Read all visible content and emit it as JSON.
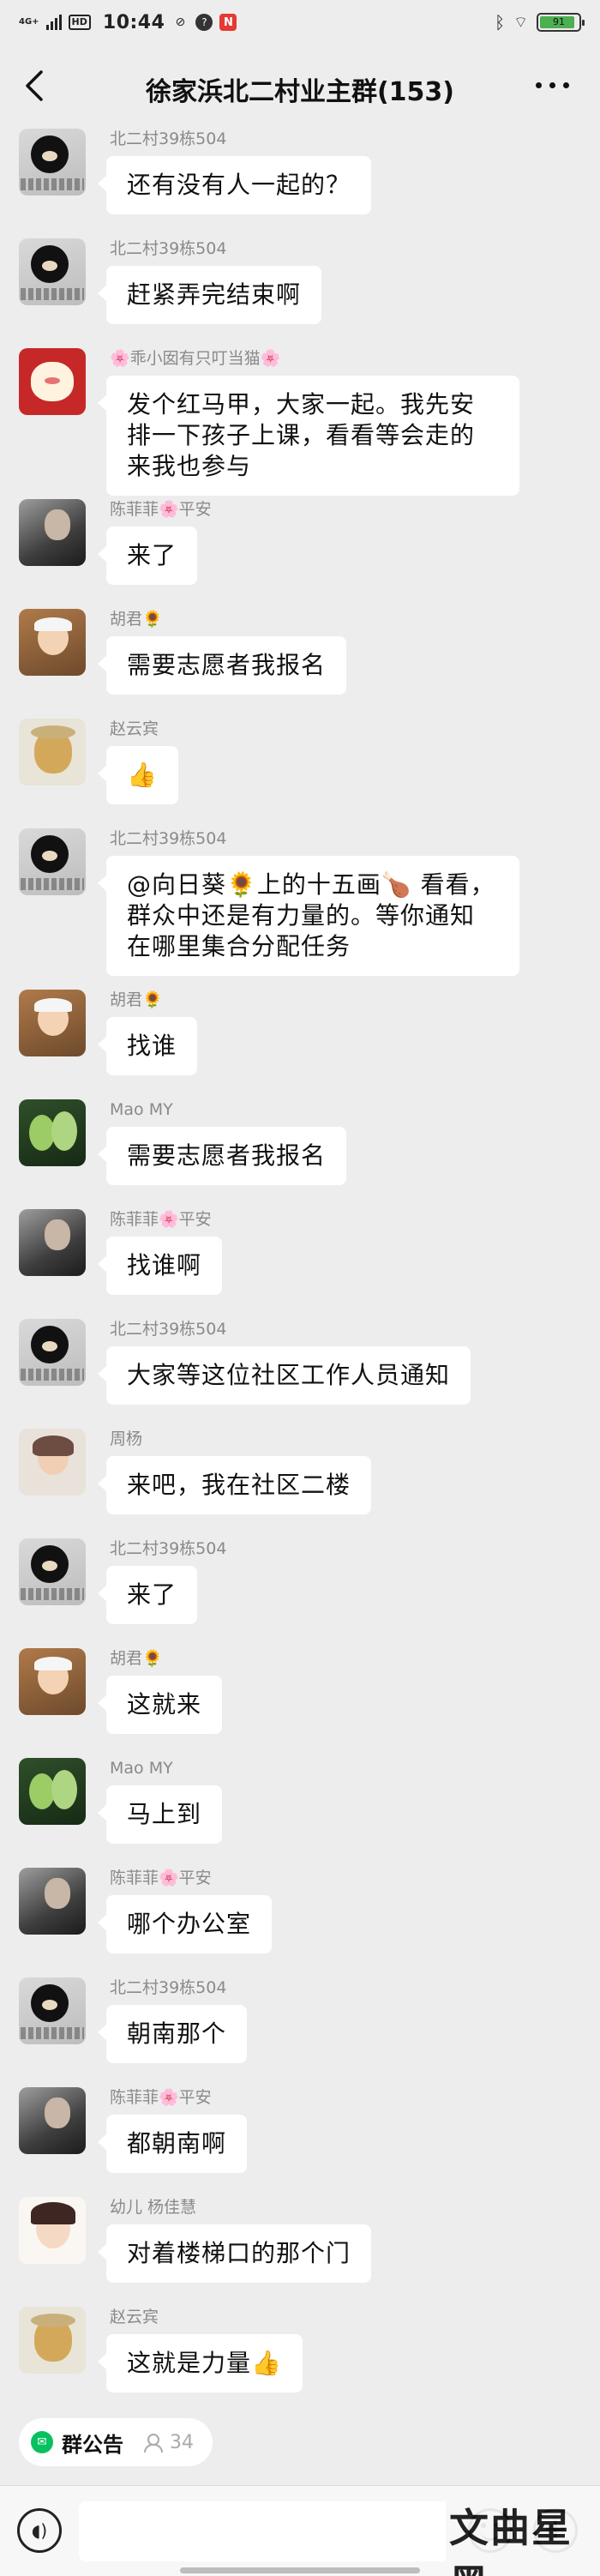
{
  "status_bar": {
    "network": "4G+",
    "hd": "HD",
    "time": "10:44",
    "battery_level": 0.91,
    "battery_text": "91",
    "bluetooth_icon": "bluetooth-icon",
    "wifi_icon": "wifi-icon"
  },
  "nav": {
    "title": "徐家浜北二村业主群(153)",
    "back_icon": "chevron-left-icon",
    "more_icon": "more-dots-icon"
  },
  "messages": [
    {
      "sender": "北二村39栋504",
      "text": "还有没有人一起的？",
      "avatar": "kuma"
    },
    {
      "sender": "北二村39栋504",
      "text": "赶紧弄完结束啊",
      "avatar": "kuma"
    },
    {
      "sender": "🌸乖小囡有只叮当猫🌸",
      "text": "发个红马甲，大家一起。我先安排一下孩子上课，看看等会走的来我也参与",
      "avatar": "cat"
    },
    {
      "sender": "陈菲菲🌸平安",
      "text": "来了",
      "avatar": "chen"
    },
    {
      "sender": "胡君🌻",
      "text": "需要志愿者我报名",
      "avatar": "hu"
    },
    {
      "sender": "赵云宾",
      "text": "👍",
      "avatar": "zhao"
    },
    {
      "sender": "北二村39栋504",
      "text": "@向日葵🌻上的十五画🍗 看看，群众中还是有力量的。等你通知在哪里集合分配任务",
      "avatar": "kuma"
    },
    {
      "sender": "胡君🌻",
      "text": "找谁",
      "avatar": "hu"
    },
    {
      "sender": "Mao MY",
      "text": "需要志愿者我报名",
      "avatar": "mao"
    },
    {
      "sender": "陈菲菲🌸平安",
      "text": "找谁啊",
      "avatar": "chen"
    },
    {
      "sender": "北二村39栋504",
      "text": "大家等这位社区工作人员通知",
      "avatar": "kuma"
    },
    {
      "sender": "周杨",
      "text": "来吧，我在社区二楼",
      "avatar": "zhou"
    },
    {
      "sender": "北二村39栋504",
      "text": "来了",
      "avatar": "kuma"
    },
    {
      "sender": "胡君🌻",
      "text": "这就来",
      "avatar": "hu"
    },
    {
      "sender": "Mao MY",
      "text": "马上到",
      "avatar": "mao"
    },
    {
      "sender": "陈菲菲🌸平安",
      "text": "哪个办公室",
      "avatar": "chen"
    },
    {
      "sender": "北二村39栋504",
      "text": "朝南那个",
      "avatar": "kuma"
    },
    {
      "sender": "陈菲菲🌸平安",
      "text": "都朝南啊",
      "avatar": "chen"
    },
    {
      "sender": "幼儿 杨佳慧",
      "text": "对着楼梯口的那个门",
      "avatar": "yang"
    },
    {
      "sender": "赵云宾",
      "text": "这就是力量👍",
      "avatar": "zhao"
    }
  ],
  "announcement": {
    "label": "群公告",
    "count": "34"
  },
  "input_bar": {
    "voice_icon": "voice-icon",
    "input_value": "",
    "emoji_icon": "emoji-icon",
    "plus_icon": "plus-icon"
  },
  "watermark": "文曲星黑"
}
